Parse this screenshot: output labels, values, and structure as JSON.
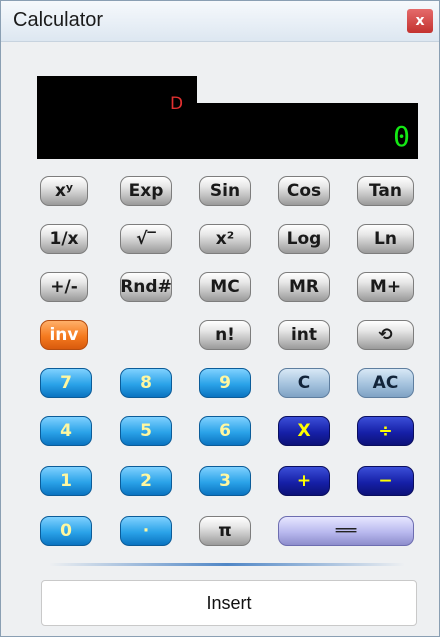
{
  "window": {
    "title": "Calculator",
    "close_label": "x"
  },
  "display": {
    "mode": "D",
    "value": "0"
  },
  "buttons": [
    {
      "label": "xʸ",
      "style": "gray"
    },
    {
      "label": "Exp",
      "style": "gray"
    },
    {
      "label": "Sin",
      "style": "gray"
    },
    {
      "label": "Cos",
      "style": "gray"
    },
    {
      "label": "Tan",
      "style": "gray"
    },
    {
      "label": "1/x",
      "style": "gray"
    },
    {
      "label": "√‾",
      "style": "gray"
    },
    {
      "label": "x²",
      "style": "gray"
    },
    {
      "label": "Log",
      "style": "gray"
    },
    {
      "label": "Ln",
      "style": "gray"
    },
    {
      "label": "+/-",
      "style": "gray"
    },
    {
      "label": "Rnd#",
      "style": "gray"
    },
    {
      "label": "MC",
      "style": "gray"
    },
    {
      "label": "MR",
      "style": "gray"
    },
    {
      "label": "M+",
      "style": "gray"
    },
    {
      "label": "inv",
      "style": "orange"
    },
    {
      "label": "n!",
      "style": "gray"
    },
    {
      "label": "int",
      "style": "gray"
    },
    {
      "label": "⟲",
      "style": "gray"
    },
    {
      "label": "7",
      "style": "blue"
    },
    {
      "label": "8",
      "style": "blue"
    },
    {
      "label": "9",
      "style": "blue"
    },
    {
      "label": "C",
      "style": "steel"
    },
    {
      "label": "AC",
      "style": "steel"
    },
    {
      "label": "4",
      "style": "blue"
    },
    {
      "label": "5",
      "style": "blue"
    },
    {
      "label": "6",
      "style": "blue"
    },
    {
      "label": "X",
      "style": "navy"
    },
    {
      "label": "÷",
      "style": "navy"
    },
    {
      "label": "1",
      "style": "blue"
    },
    {
      "label": "2",
      "style": "blue"
    },
    {
      "label": "3",
      "style": "blue"
    },
    {
      "label": "+",
      "style": "navy"
    },
    {
      "label": "−",
      "style": "navy"
    },
    {
      "label": "0",
      "style": "blue"
    },
    {
      "label": "·",
      "style": "blue"
    },
    {
      "label": "π",
      "style": "gray"
    },
    {
      "label": "══",
      "style": "equals"
    }
  ],
  "insert_label": "Insert",
  "colors": {
    "display_bg": "#000000",
    "display_digits": "#14e814",
    "mode_indicator": "#e03030",
    "title_close": "#c3322f"
  }
}
